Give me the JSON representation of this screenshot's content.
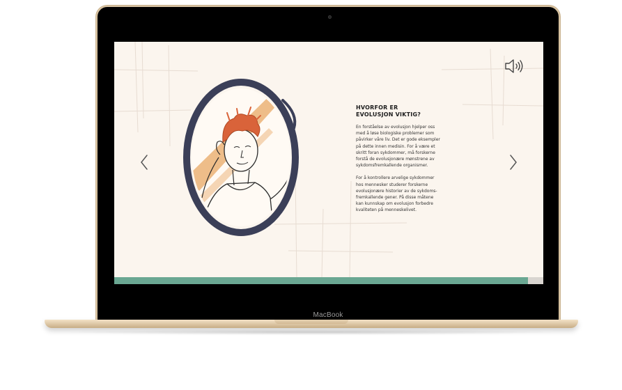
{
  "device": {
    "brand": "MacBook"
  },
  "slide": {
    "heading": "HVORFOR ER\nEVOLUSJON VIKTIG?",
    "paragraph1": "En forståelse av evolusjon hjelper oss\nmed å løse biologiske problemer som\npåvirker våre liv. Det er gode eksempler\npå dette innen medisin. For å være et\nskritt foran sykdommer, må forskerne\nforstå de evolusjonære mønstrene av\nsykdomsfremkallende organismer.",
    "paragraph2": "For å kontrollere arvelige sykdommer\nhos mennesker studerer forskerne\nevolusjonære historier av de sykdoms-\nfremkallende gener. På disse måtene\nkan kunnskap om evolusjon forbedre\nkvaliteten på menneskelivet."
  },
  "controls": {
    "sound_icon": "speaker-icon",
    "prev_icon": "chevron-left-icon",
    "next_icon": "chevron-right-icon"
  },
  "progress": {
    "fraction": 0.965
  },
  "colors": {
    "screen_bg": "#fbf5ee",
    "progress_fill": "#6aa792",
    "mirror_frame": "#3b3f58",
    "hair": "#d9633a",
    "streak": "#e8a866",
    "laptop_gold": "#d9c4a3"
  }
}
